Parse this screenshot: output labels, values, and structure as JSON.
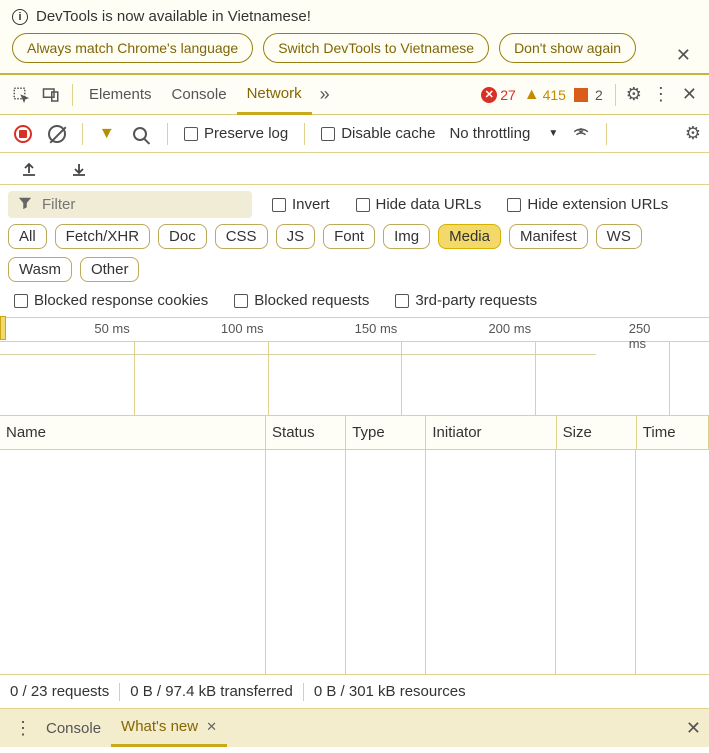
{
  "banner": {
    "title": "DevTools is now available in Vietnamese!",
    "buttons": [
      "Always match Chrome's language",
      "Switch DevTools to Vietnamese",
      "Don't show again"
    ]
  },
  "tabs": {
    "items": [
      "Elements",
      "Console",
      "Network"
    ],
    "active": "Network"
  },
  "issues": {
    "errors": "27",
    "warnings": "415",
    "issues": "2"
  },
  "toolbar": {
    "preserve_log": "Preserve log",
    "disable_cache": "Disable cache",
    "throttling": "No throttling"
  },
  "filters": {
    "placeholder": "Filter",
    "invert": "Invert",
    "hide_data": "Hide data URLs",
    "hide_ext": "Hide extension URLs",
    "types": [
      "All",
      "Fetch/XHR",
      "Doc",
      "CSS",
      "JS",
      "Font",
      "Img",
      "Media",
      "Manifest",
      "WS",
      "Wasm",
      "Other"
    ],
    "active_type": "Media",
    "blocked_cookies": "Blocked response cookies",
    "blocked_req": "Blocked requests",
    "third_party": "3rd-party requests"
  },
  "timeline": {
    "ticks": [
      "50 ms",
      "100 ms",
      "150 ms",
      "200 ms",
      "250 ms"
    ]
  },
  "table": {
    "columns": [
      "Name",
      "Status",
      "Type",
      "Initiator",
      "Size",
      "Time"
    ]
  },
  "statusbar": {
    "requests": "0 / 23 requests",
    "transferred": "0 B / 97.4 kB transferred",
    "resources": "0 B / 301 kB resources"
  },
  "drawer": {
    "tabs": [
      "Console",
      "What's new"
    ],
    "active": "What's new"
  }
}
